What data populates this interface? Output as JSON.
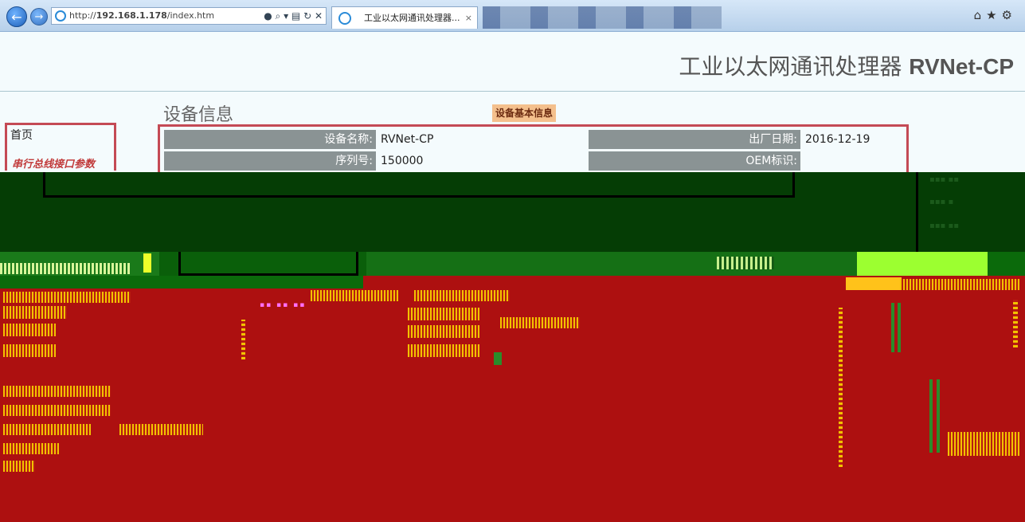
{
  "browser": {
    "url_prefix": "http://",
    "url_host": "192.168.1.178",
    "url_path": "/index.htm",
    "tab_title": "工业以太网通讯处理器...",
    "back_icon": "back-arrow-icon",
    "forward_icon": "forward-arrow-icon",
    "toolbar_icons": [
      "home-icon",
      "favorites-star-icon",
      "settings-gear-icon"
    ]
  },
  "header": {
    "title_cn": "工业以太网通讯处理器",
    "title_model": "RVNet-CP"
  },
  "nav": {
    "items": [
      {
        "label": "首页"
      },
      {
        "label": "串行总线接口参数"
      }
    ]
  },
  "device": {
    "section_title": "设备信息",
    "section_badge": "设备基本信息",
    "rows": [
      {
        "label": "设备名称:",
        "value": "RVNet-CP",
        "label2": "出厂日期:",
        "value2": "2016-12-19"
      },
      {
        "label": "序列号:",
        "value": "150000",
        "label2": "OEM标识:",
        "value2": ""
      }
    ]
  },
  "colors": {
    "page_bg": "#f4fbfd",
    "accent_border": "#c44a55",
    "label_bg": "#8a9394",
    "badge_bg": "#f4c08d",
    "glitch_dark": "#053d05",
    "glitch_red": "#ad1010"
  }
}
